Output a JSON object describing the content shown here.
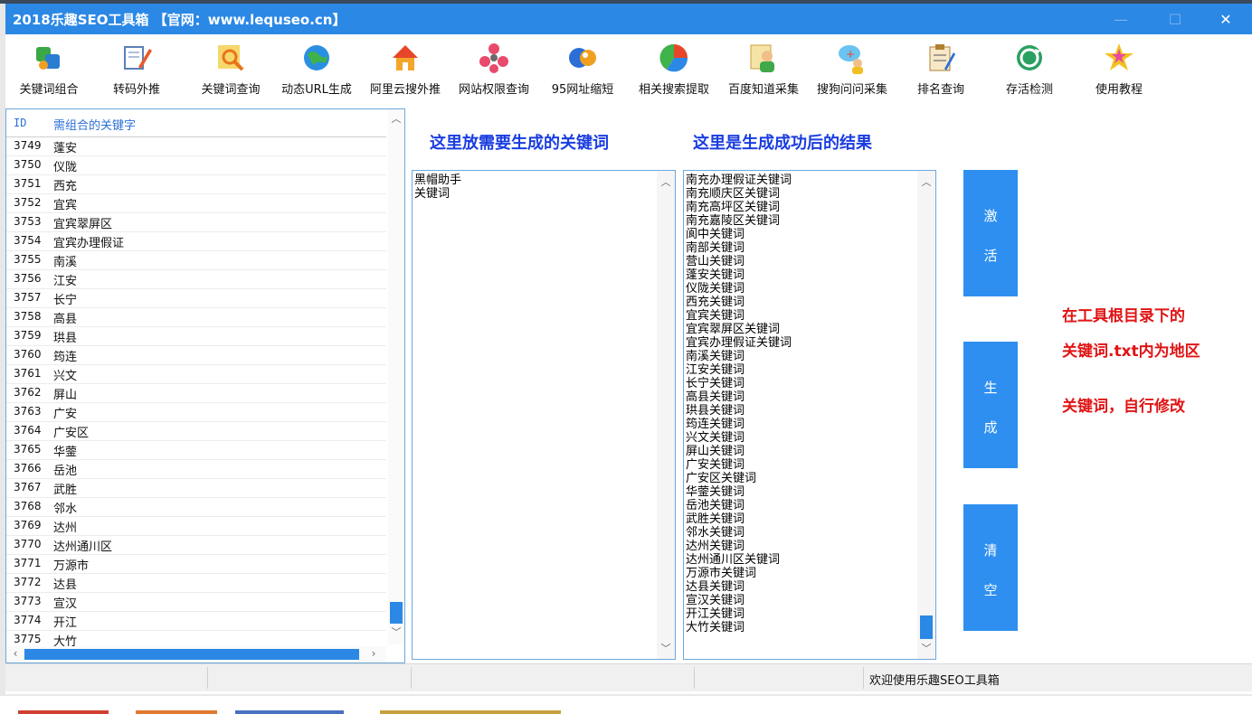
{
  "window": {
    "title": "2018乐趣SEO工具箱 【官网：www.lequseo.cn】",
    "minimize_glyph": "—",
    "maximize_glyph": "☐",
    "close_glyph": "✕"
  },
  "toolbar": {
    "items": [
      {
        "label": "关键词组合",
        "icon": "keyword-combo-icon"
      },
      {
        "label": "转码外推",
        "icon": "transcode-push-icon"
      },
      {
        "label": "关键词查询",
        "icon": "keyword-query-icon"
      },
      {
        "label": "动态URL生成",
        "icon": "dynamic-url-icon"
      },
      {
        "label": "阿里云搜外推",
        "icon": "aliyun-push-icon"
      },
      {
        "label": "网站权限查询",
        "icon": "site-authority-icon"
      },
      {
        "label": "95网址缩短",
        "icon": "url-shorten-icon"
      },
      {
        "label": "相关搜索提取",
        "icon": "related-search-icon"
      },
      {
        "label": "百度知道采集",
        "icon": "baidu-zhidao-icon"
      },
      {
        "label": "搜狗问问采集",
        "icon": "sogou-wenwen-icon"
      },
      {
        "label": "排名查询",
        "icon": "rank-query-icon"
      },
      {
        "label": "存活检测",
        "icon": "alive-check-icon"
      },
      {
        "label": "使用教程",
        "icon": "tutorial-icon"
      }
    ]
  },
  "keyword_list": {
    "col_id": "ID",
    "col_keyword": "需组合的关键字",
    "rows": [
      {
        "id": "3749",
        "kw": "蓬安"
      },
      {
        "id": "3750",
        "kw": "仪陇"
      },
      {
        "id": "3751",
        "kw": "西充"
      },
      {
        "id": "3752",
        "kw": "宜宾"
      },
      {
        "id": "3753",
        "kw": "宜宾翠屏区"
      },
      {
        "id": "3754",
        "kw": "宜宾办理假证"
      },
      {
        "id": "3755",
        "kw": "南溪"
      },
      {
        "id": "3756",
        "kw": "江安"
      },
      {
        "id": "3757",
        "kw": "长宁"
      },
      {
        "id": "3758",
        "kw": "高县"
      },
      {
        "id": "3759",
        "kw": "珙县"
      },
      {
        "id": "3760",
        "kw": "筠连"
      },
      {
        "id": "3761",
        "kw": "兴文"
      },
      {
        "id": "3762",
        "kw": "屏山"
      },
      {
        "id": "3763",
        "kw": "广安"
      },
      {
        "id": "3764",
        "kw": "广安区"
      },
      {
        "id": "3765",
        "kw": "华蓥"
      },
      {
        "id": "3766",
        "kw": "岳池"
      },
      {
        "id": "3767",
        "kw": "武胜"
      },
      {
        "id": "3768",
        "kw": "邻水"
      },
      {
        "id": "3769",
        "kw": "达州"
      },
      {
        "id": "3770",
        "kw": "达州通川区"
      },
      {
        "id": "3771",
        "kw": "万源市"
      },
      {
        "id": "3772",
        "kw": "达县"
      },
      {
        "id": "3773",
        "kw": "宣汉"
      },
      {
        "id": "3774",
        "kw": "开江"
      },
      {
        "id": "3775",
        "kw": "大竹"
      }
    ]
  },
  "input_section": {
    "heading": "这里放需要生成的关键词",
    "text": "黑帽助手\n关键词"
  },
  "result_section": {
    "heading": "这里是生成成功后的结果",
    "text": "南充办理假证关键词\n南充顺庆区关键词\n南充高坪区关键词\n南充嘉陵区关键词\n阆中关键词\n南部关键词\n营山关键词\n蓬安关键词\n仪陇关键词\n西充关键词\n宜宾关键词\n宜宾翠屏区关键词\n宜宾办理假证关键词\n南溪关键词\n江安关键词\n长宁关键词\n高县关键词\n珙县关键词\n筠连关键词\n兴文关键词\n屏山关键词\n广安关键词\n广安区关键词\n华蓥关键词\n岳池关键词\n武胜关键词\n邻水关键词\n达州关键词\n达州通川区关键词\n万源市关键词\n达县关键词\n宣汉关键词\n开江关键词\n大竹关键词"
  },
  "buttons": {
    "activate": [
      "激",
      "活"
    ],
    "generate": [
      "生",
      "成"
    ],
    "clear": [
      "清",
      "空"
    ]
  },
  "note": {
    "line1": "在工具根目录下的",
    "line2": "关键词.txt内为地区",
    "line3": "关键词，自行修改"
  },
  "status": {
    "message": "欢迎使用乐趣SEO工具箱"
  },
  "colors": {
    "accent": "#2b88e5",
    "heading": "#1a3de0",
    "note": "#e01414"
  }
}
